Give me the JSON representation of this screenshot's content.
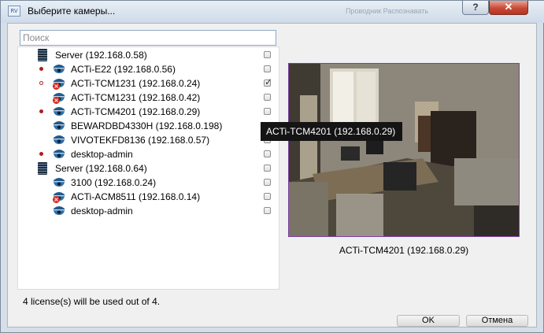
{
  "window": {
    "title": "Выберите камеры...",
    "app_icon_text": "RV",
    "title_faded": "Проводник  Распознавать",
    "help_label": "?",
    "close_label": "✕"
  },
  "search": {
    "placeholder": "Поиск",
    "value": ""
  },
  "tree": {
    "rows": [
      {
        "type": "server",
        "label": "Server (192.168.0.58)",
        "checked": false
      },
      {
        "type": "camera",
        "label": "ACTi-E22 (192.168.0.56)",
        "indicator": "filled",
        "error": false,
        "checked": false
      },
      {
        "type": "camera",
        "label": "ACTi-TCM1231 (192.168.0.24)",
        "indicator": "hollow",
        "error": true,
        "checked": true
      },
      {
        "type": "camera",
        "label": "ACTi-TCM1231 (192.168.0.42)",
        "indicator": "none",
        "error": true,
        "checked": false
      },
      {
        "type": "camera",
        "label": "ACTi-TCM4201 (192.168.0.29)",
        "indicator": "filled",
        "error": false,
        "checked": false
      },
      {
        "type": "camera",
        "label": "BEWARDBD4330H (192.168.0.198)",
        "indicator": "none",
        "error": false,
        "checked": false
      },
      {
        "type": "camera",
        "label": "VIVOTEKFD8136 (192.168.0.57)",
        "indicator": "none",
        "error": false,
        "checked": false
      },
      {
        "type": "camera",
        "label": "desktop-admin",
        "indicator": "filled",
        "error": false,
        "checked": false
      },
      {
        "type": "server",
        "label": "Server (192.168.0.64)",
        "checked": false
      },
      {
        "type": "camera",
        "label": "3100 (192.168.0.24)",
        "indicator": "none",
        "error": false,
        "checked": false
      },
      {
        "type": "camera",
        "label": "ACTi-ACM8511 (192.168.0.14)",
        "indicator": "none",
        "error": true,
        "checked": false
      },
      {
        "type": "camera",
        "label": "desktop-admin",
        "indicator": "none",
        "error": false,
        "checked": false
      }
    ]
  },
  "tooltip": "ACTi-TCM4201 (192.168.0.29)",
  "preview": {
    "caption": "ACTi-TCM4201 (192.168.0.29)"
  },
  "license_text": "4 license(s) will be used out of 4.",
  "buttons": {
    "ok": "OK",
    "cancel": "Отмена"
  },
  "colors": {
    "indicator_red": "#b01e1e",
    "error_red": "#d42a1e",
    "preview_border": "#7c3fa3",
    "camera_icon": "#2e6fa8"
  }
}
